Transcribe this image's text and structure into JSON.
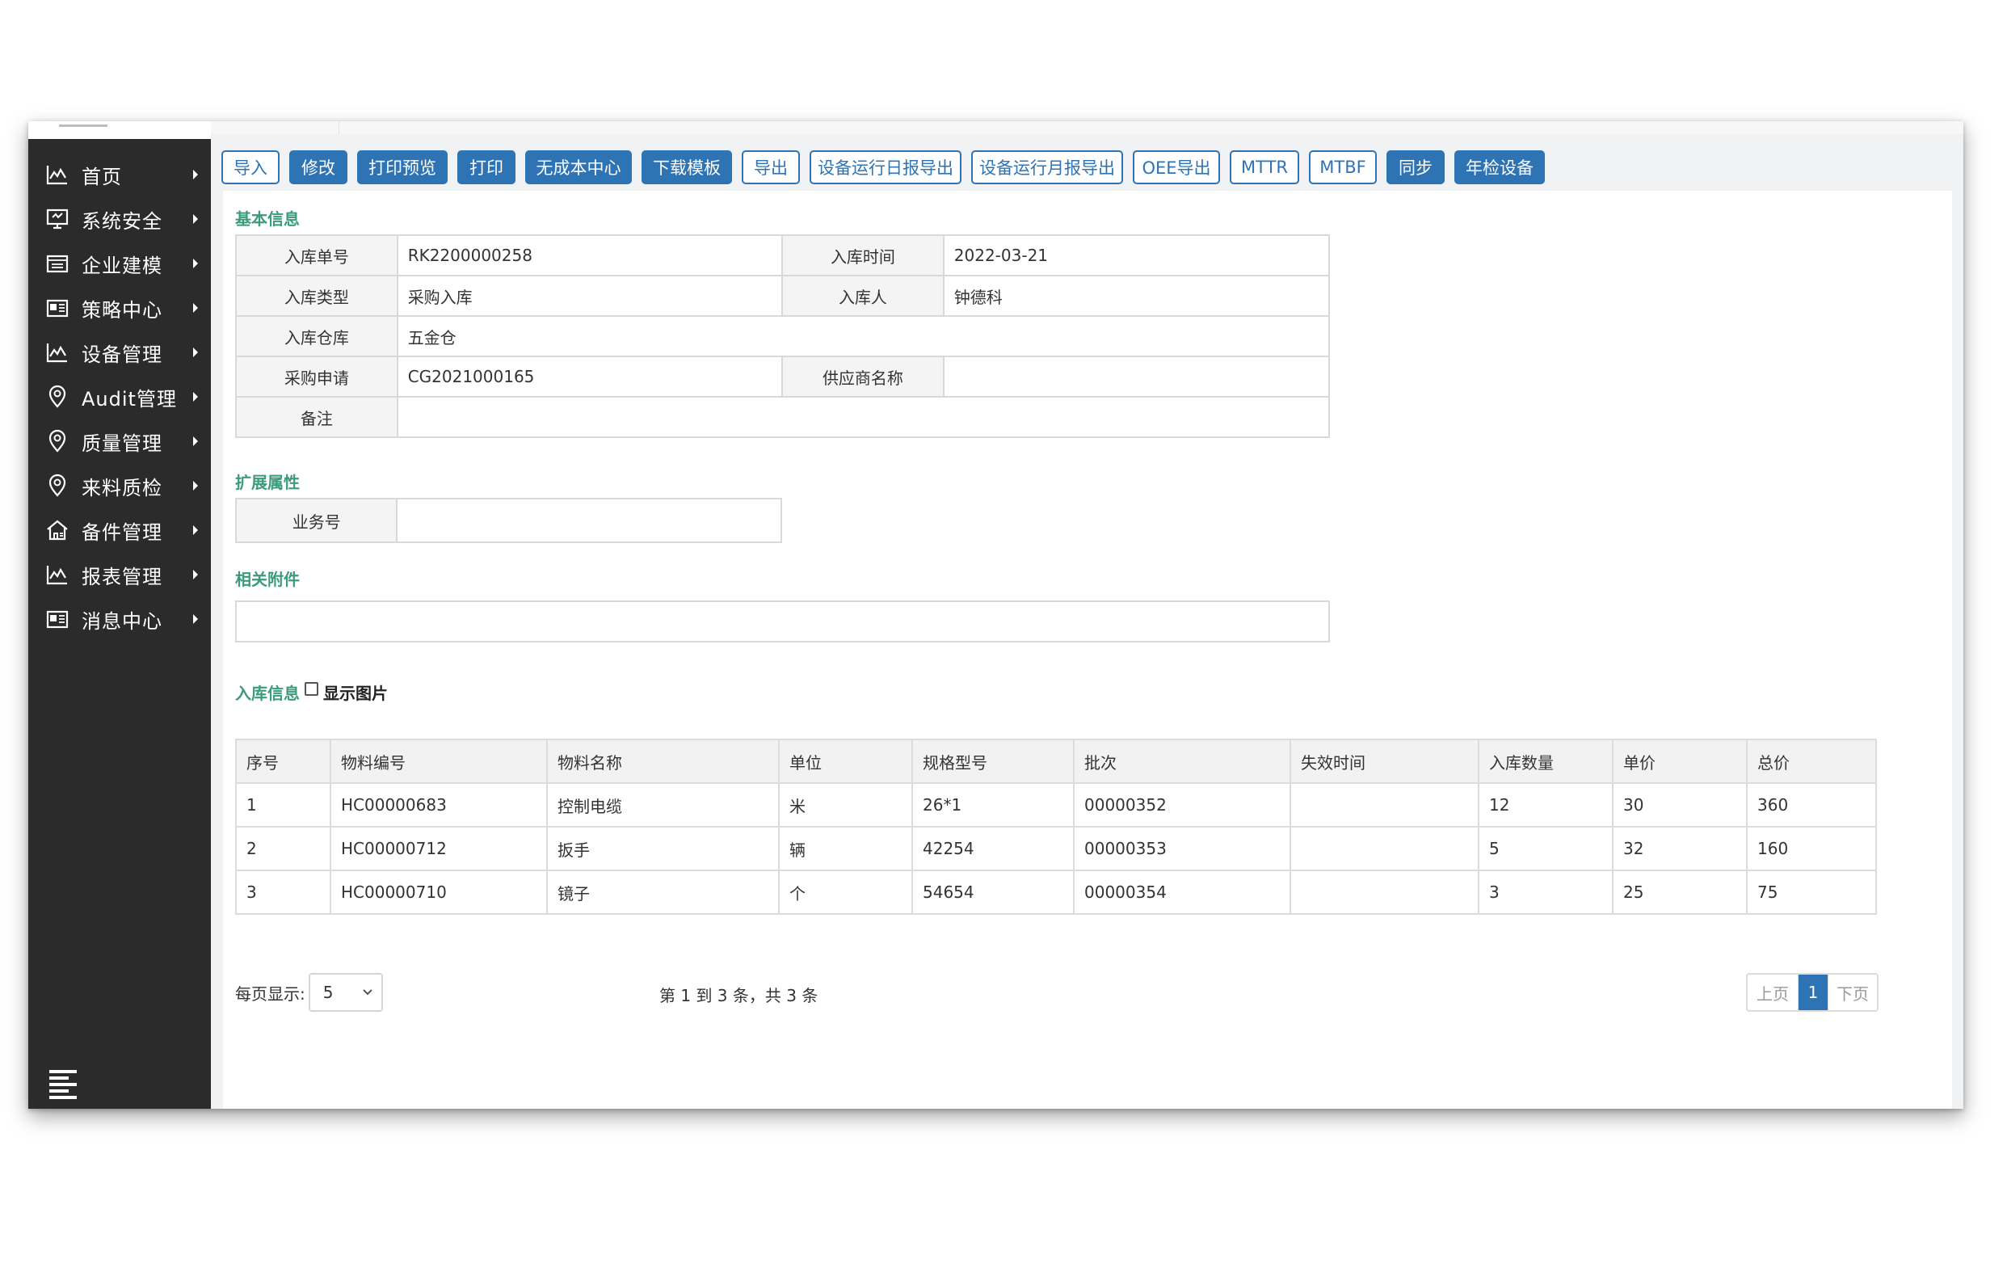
{
  "sidebar": {
    "items": [
      {
        "label": "首页",
        "icon": "line-chart-icon"
      },
      {
        "label": "系统安全",
        "icon": "monitor-icon"
      },
      {
        "label": "企业建模",
        "icon": "calendar-icon"
      },
      {
        "label": "策略中心",
        "icon": "news-icon"
      },
      {
        "label": "设备管理",
        "icon": "line-chart-icon"
      },
      {
        "label": "Audit管理",
        "icon": "location-pin-icon"
      },
      {
        "label": "质量管理",
        "icon": "location-pin-icon"
      },
      {
        "label": "来料质检",
        "icon": "location-pin-icon"
      },
      {
        "label": "备件管理",
        "icon": "home-icon"
      },
      {
        "label": "报表管理",
        "icon": "line-chart-icon"
      },
      {
        "label": "消息中心",
        "icon": "news-icon"
      }
    ]
  },
  "toolbar": {
    "buttons": [
      {
        "label": "导入",
        "style": "outline"
      },
      {
        "label": "修改",
        "style": "filled"
      },
      {
        "label": "打印预览",
        "style": "filled"
      },
      {
        "label": "打印",
        "style": "filled"
      },
      {
        "label": "无成本中心",
        "style": "filled"
      },
      {
        "label": "下载模板",
        "style": "filled"
      },
      {
        "label": "导出",
        "style": "outline"
      },
      {
        "label": "设备运行日报导出",
        "style": "outline"
      },
      {
        "label": "设备运行月报导出",
        "style": "outline"
      },
      {
        "label": "OEE导出",
        "style": "outline"
      },
      {
        "label": "MTTR",
        "style": "outline"
      },
      {
        "label": "MTBF",
        "style": "outline"
      },
      {
        "label": "同步",
        "style": "filled"
      },
      {
        "label": "年检设备",
        "style": "filled"
      }
    ]
  },
  "basic_info": {
    "title": "基本信息",
    "order_no_label": "入库单号",
    "order_no": "RK2200000258",
    "time_label": "入库时间",
    "time": "2022-03-21",
    "type_label": "入库类型",
    "type": "采购入库",
    "person_label": "入库人",
    "person": "钟德科",
    "warehouse_label": "入库仓库",
    "warehouse": "五金仓",
    "purchase_label": "采购申请",
    "purchase": "CG2021000165",
    "supplier_label": "供应商名称",
    "supplier": "",
    "remark_label": "备注",
    "remark": ""
  },
  "ext": {
    "title": "扩展属性",
    "business_label": "业务号",
    "business": ""
  },
  "attachments": {
    "title": "相关附件"
  },
  "inbound": {
    "title": "入库信息",
    "show_image_label": "显示图片",
    "columns": [
      "序号",
      "物料编号",
      "物料名称",
      "单位",
      "规格型号",
      "批次",
      "失效时间",
      "入库数量",
      "单价",
      "总价"
    ],
    "rows": [
      [
        "1",
        "HC00000683",
        "控制电缆",
        "米",
        "26*1",
        "00000352",
        "",
        "12",
        "30",
        "360"
      ],
      [
        "2",
        "HC00000712",
        "扳手",
        "辆",
        "42254",
        "00000353",
        "",
        "5",
        "32",
        "160"
      ],
      [
        "3",
        "HC00000710",
        "镜子",
        "个",
        "54654",
        "00000354",
        "",
        "3",
        "25",
        "75"
      ]
    ]
  },
  "pagination": {
    "page_size_label": "每页显示:",
    "page_size": "5",
    "summary": "第 1 到 3 条，共 3 条",
    "prev": "上页",
    "current": "1",
    "next": "下页"
  },
  "colors": {
    "sidebar": "#2b2b2b",
    "primary": "#2e74b5",
    "section_title": "#3c9a7d"
  }
}
